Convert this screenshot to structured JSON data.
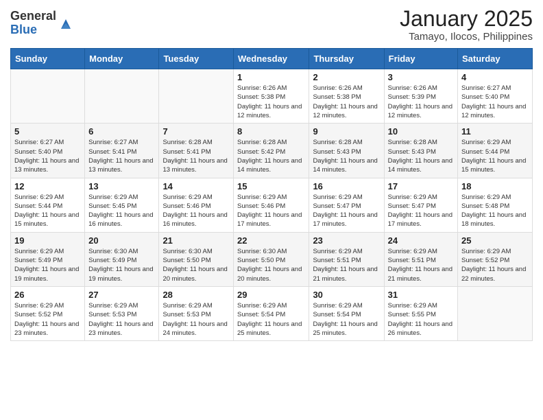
{
  "logo": {
    "general": "General",
    "blue": "Blue"
  },
  "title": "January 2025",
  "location": "Tamayo, Ilocos, Philippines",
  "days_of_week": [
    "Sunday",
    "Monday",
    "Tuesday",
    "Wednesday",
    "Thursday",
    "Friday",
    "Saturday"
  ],
  "weeks": [
    [
      {
        "day": "",
        "info": ""
      },
      {
        "day": "",
        "info": ""
      },
      {
        "day": "",
        "info": ""
      },
      {
        "day": "1",
        "info": "Sunrise: 6:26 AM\nSunset: 5:38 PM\nDaylight: 11 hours and 12 minutes."
      },
      {
        "day": "2",
        "info": "Sunrise: 6:26 AM\nSunset: 5:38 PM\nDaylight: 11 hours and 12 minutes."
      },
      {
        "day": "3",
        "info": "Sunrise: 6:26 AM\nSunset: 5:39 PM\nDaylight: 11 hours and 12 minutes."
      },
      {
        "day": "4",
        "info": "Sunrise: 6:27 AM\nSunset: 5:40 PM\nDaylight: 11 hours and 12 minutes."
      }
    ],
    [
      {
        "day": "5",
        "info": "Sunrise: 6:27 AM\nSunset: 5:40 PM\nDaylight: 11 hours and 13 minutes."
      },
      {
        "day": "6",
        "info": "Sunrise: 6:27 AM\nSunset: 5:41 PM\nDaylight: 11 hours and 13 minutes."
      },
      {
        "day": "7",
        "info": "Sunrise: 6:28 AM\nSunset: 5:41 PM\nDaylight: 11 hours and 13 minutes."
      },
      {
        "day": "8",
        "info": "Sunrise: 6:28 AM\nSunset: 5:42 PM\nDaylight: 11 hours and 14 minutes."
      },
      {
        "day": "9",
        "info": "Sunrise: 6:28 AM\nSunset: 5:43 PM\nDaylight: 11 hours and 14 minutes."
      },
      {
        "day": "10",
        "info": "Sunrise: 6:28 AM\nSunset: 5:43 PM\nDaylight: 11 hours and 14 minutes."
      },
      {
        "day": "11",
        "info": "Sunrise: 6:29 AM\nSunset: 5:44 PM\nDaylight: 11 hours and 15 minutes."
      }
    ],
    [
      {
        "day": "12",
        "info": "Sunrise: 6:29 AM\nSunset: 5:44 PM\nDaylight: 11 hours and 15 minutes."
      },
      {
        "day": "13",
        "info": "Sunrise: 6:29 AM\nSunset: 5:45 PM\nDaylight: 11 hours and 16 minutes."
      },
      {
        "day": "14",
        "info": "Sunrise: 6:29 AM\nSunset: 5:46 PM\nDaylight: 11 hours and 16 minutes."
      },
      {
        "day": "15",
        "info": "Sunrise: 6:29 AM\nSunset: 5:46 PM\nDaylight: 11 hours and 17 minutes."
      },
      {
        "day": "16",
        "info": "Sunrise: 6:29 AM\nSunset: 5:47 PM\nDaylight: 11 hours and 17 minutes."
      },
      {
        "day": "17",
        "info": "Sunrise: 6:29 AM\nSunset: 5:47 PM\nDaylight: 11 hours and 17 minutes."
      },
      {
        "day": "18",
        "info": "Sunrise: 6:29 AM\nSunset: 5:48 PM\nDaylight: 11 hours and 18 minutes."
      }
    ],
    [
      {
        "day": "19",
        "info": "Sunrise: 6:29 AM\nSunset: 5:49 PM\nDaylight: 11 hours and 19 minutes."
      },
      {
        "day": "20",
        "info": "Sunrise: 6:30 AM\nSunset: 5:49 PM\nDaylight: 11 hours and 19 minutes."
      },
      {
        "day": "21",
        "info": "Sunrise: 6:30 AM\nSunset: 5:50 PM\nDaylight: 11 hours and 20 minutes."
      },
      {
        "day": "22",
        "info": "Sunrise: 6:30 AM\nSunset: 5:50 PM\nDaylight: 11 hours and 20 minutes."
      },
      {
        "day": "23",
        "info": "Sunrise: 6:29 AM\nSunset: 5:51 PM\nDaylight: 11 hours and 21 minutes."
      },
      {
        "day": "24",
        "info": "Sunrise: 6:29 AM\nSunset: 5:51 PM\nDaylight: 11 hours and 21 minutes."
      },
      {
        "day": "25",
        "info": "Sunrise: 6:29 AM\nSunset: 5:52 PM\nDaylight: 11 hours and 22 minutes."
      }
    ],
    [
      {
        "day": "26",
        "info": "Sunrise: 6:29 AM\nSunset: 5:52 PM\nDaylight: 11 hours and 23 minutes."
      },
      {
        "day": "27",
        "info": "Sunrise: 6:29 AM\nSunset: 5:53 PM\nDaylight: 11 hours and 23 minutes."
      },
      {
        "day": "28",
        "info": "Sunrise: 6:29 AM\nSunset: 5:53 PM\nDaylight: 11 hours and 24 minutes."
      },
      {
        "day": "29",
        "info": "Sunrise: 6:29 AM\nSunset: 5:54 PM\nDaylight: 11 hours and 25 minutes."
      },
      {
        "day": "30",
        "info": "Sunrise: 6:29 AM\nSunset: 5:54 PM\nDaylight: 11 hours and 25 minutes."
      },
      {
        "day": "31",
        "info": "Sunrise: 6:29 AM\nSunset: 5:55 PM\nDaylight: 11 hours and 26 minutes."
      },
      {
        "day": "",
        "info": ""
      }
    ]
  ]
}
